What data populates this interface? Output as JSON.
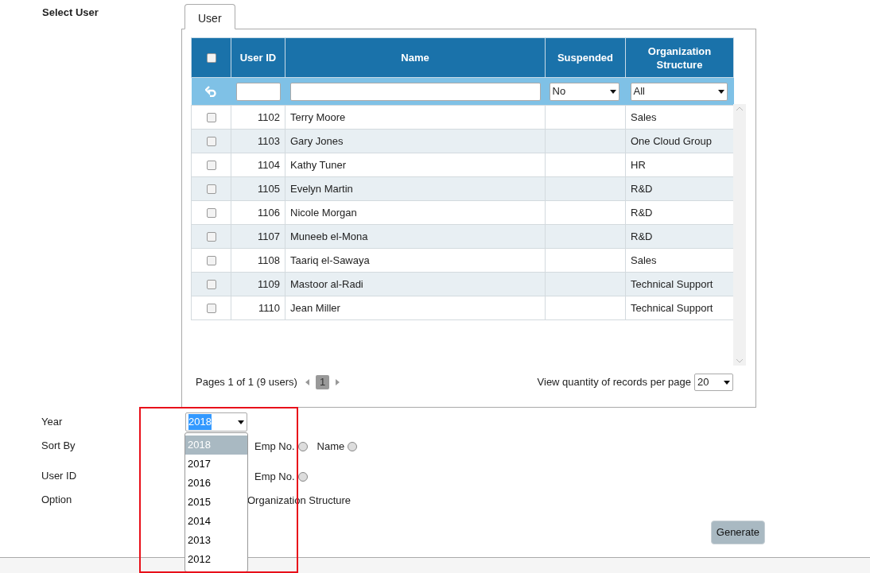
{
  "section_label": "Select User",
  "tabs": [
    {
      "label": "User",
      "selected": true
    }
  ],
  "table": {
    "header_checkbox": {
      "checked": false
    },
    "columns": [
      "User ID",
      "Name",
      "Suspended",
      "Organization Structure"
    ],
    "filters": {
      "suspended": "No",
      "organization": "All"
    },
    "rows": [
      {
        "checked": false,
        "user_id": "1102",
        "name": "Terry Moore",
        "organization": "Sales"
      },
      {
        "checked": false,
        "user_id": "1103",
        "name": "Gary Jones",
        "organization": "One Cloud Group"
      },
      {
        "checked": false,
        "user_id": "1104",
        "name": "Kathy Tuner",
        "organization": "HR"
      },
      {
        "checked": false,
        "user_id": "1105",
        "name": "Evelyn Martin",
        "organization": "R&D"
      },
      {
        "checked": false,
        "user_id": "1106",
        "name": "Nicole Morgan",
        "organization": "R&D"
      },
      {
        "checked": false,
        "user_id": "1107",
        "name": "Muneeb el-Mona",
        "organization": "R&D"
      },
      {
        "checked": false,
        "user_id": "1108",
        "name": "Taariq el-Sawaya",
        "organization": "Sales"
      },
      {
        "checked": false,
        "user_id": "1109",
        "name": "Mastoor al-Radi",
        "organization": "Technical Support"
      },
      {
        "checked": false,
        "user_id": "1110",
        "name": "Jean Miller",
        "organization": "Technical Support"
      }
    ],
    "pager": {
      "summary": "Pages 1 of 1 (9 users)",
      "page": "1",
      "per_page_label": "View quantity of records per page",
      "per_page": "20"
    }
  },
  "form": {
    "year": {
      "label": "Year",
      "value": "2018",
      "options": [
        {
          "label": "2018",
          "selected": true
        },
        {
          "label": "2017",
          "selected": false
        },
        {
          "label": "2016",
          "selected": false
        },
        {
          "label": "2015",
          "selected": false
        },
        {
          "label": "2014",
          "selected": false
        },
        {
          "label": "2013",
          "selected": false
        },
        {
          "label": "2012",
          "selected": false
        }
      ]
    },
    "sort_by": {
      "label": "Sort By",
      "options": [
        {
          "label": "Emp No.",
          "selected": false
        },
        {
          "label": "Name",
          "selected": false
        }
      ]
    },
    "user_id": {
      "label": "User ID",
      "options": [
        {
          "label": "Emp No.",
          "selected": false
        }
      ]
    },
    "option": {
      "label": "Option",
      "text": "Organization Structure"
    },
    "button": "Generate"
  }
}
